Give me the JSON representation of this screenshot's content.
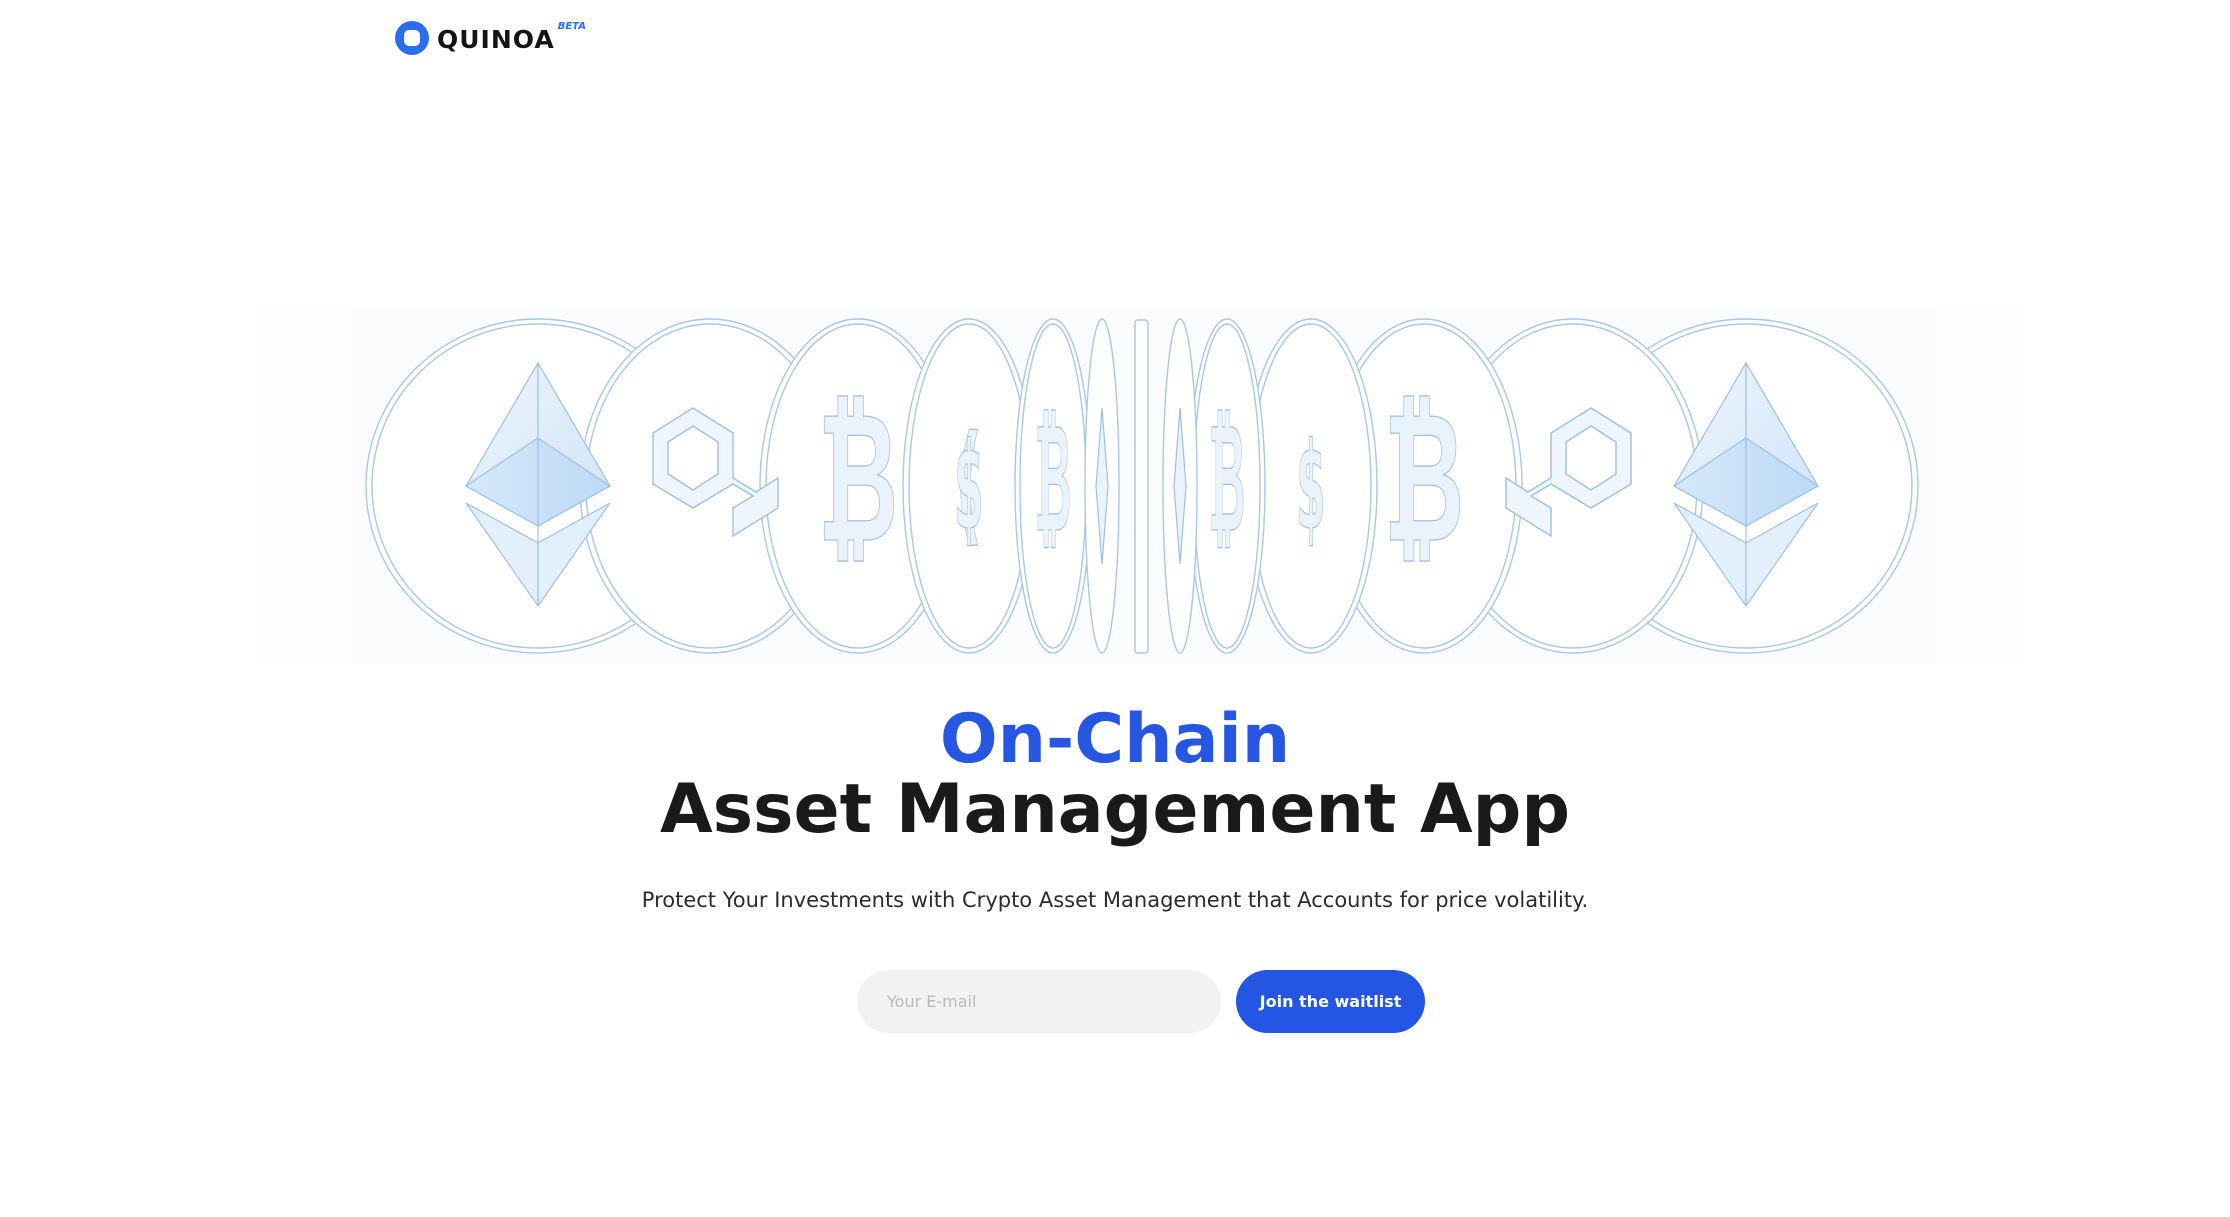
{
  "header": {
    "logo_text": "QUINOA",
    "beta_badge": "BETA",
    "logo_icon": "quinoa-logo-icon"
  },
  "hero": {
    "illustration_coins": [
      "ethereum",
      "polygon",
      "bitcoin",
      "dollar",
      "bitcoin",
      "diamond",
      "bitcoin",
      "dollar",
      "bitcoin",
      "polygon",
      "ethereum"
    ],
    "headline_accent": "On-Chain",
    "headline_main": "Asset Management App",
    "subtitle": "Protect Your Investments with Crypto Asset Management that Accounts for price volatility."
  },
  "waitlist": {
    "email_placeholder": "Your E-mail",
    "email_value": "",
    "button_label": "Join the waitlist"
  },
  "colors": {
    "accent": "#2456e3",
    "logo": "#2a6df0",
    "text": "#1a1a1a",
    "input_bg": "#f2f2f2",
    "coin_stroke": "#9ec0e3",
    "coin_fill": "#eaf3fc"
  }
}
